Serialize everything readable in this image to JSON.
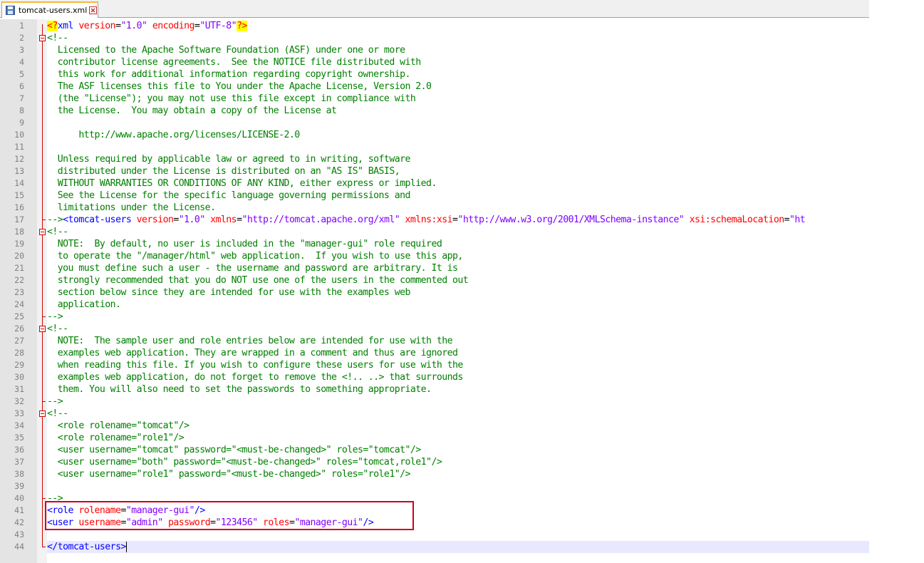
{
  "tab": {
    "filename": "tomcat-users.xml"
  },
  "lines": [
    [
      {
        "c": "pi",
        "t": "<?"
      },
      {
        "c": "tag",
        "t": "xml"
      },
      {
        "c": "text",
        "t": " "
      },
      {
        "c": "attr",
        "t": "version"
      },
      {
        "c": "text",
        "t": "="
      },
      {
        "c": "val",
        "t": "\"1.0\""
      },
      {
        "c": "text",
        "t": " "
      },
      {
        "c": "attr",
        "t": "encoding"
      },
      {
        "c": "text",
        "t": "="
      },
      {
        "c": "val",
        "t": "\"UTF-8\""
      },
      {
        "c": "pi",
        "t": "?>"
      }
    ],
    [
      {
        "c": "comment",
        "t": "<!--"
      }
    ],
    [
      {
        "c": "comment",
        "t": "  Licensed to the Apache Software Foundation (ASF) under one or more"
      }
    ],
    [
      {
        "c": "comment",
        "t": "  contributor license agreements.  See the NOTICE file distributed with"
      }
    ],
    [
      {
        "c": "comment",
        "t": "  this work for additional information regarding copyright ownership."
      }
    ],
    [
      {
        "c": "comment",
        "t": "  The ASF licenses this file to You under the Apache License, Version 2.0"
      }
    ],
    [
      {
        "c": "comment",
        "t": "  (the \"License\"); you may not use this file except in compliance with"
      }
    ],
    [
      {
        "c": "comment",
        "t": "  the License.  You may obtain a copy of the License at"
      }
    ],
    [
      {
        "c": "comment",
        "t": ""
      }
    ],
    [
      {
        "c": "comment",
        "t": "      http://www.apache.org/licenses/LICENSE-2.0"
      }
    ],
    [
      {
        "c": "comment",
        "t": ""
      }
    ],
    [
      {
        "c": "comment",
        "t": "  Unless required by applicable law or agreed to in writing, software"
      }
    ],
    [
      {
        "c": "comment",
        "t": "  distributed under the License is distributed on an \"AS IS\" BASIS,"
      }
    ],
    [
      {
        "c": "comment",
        "t": "  WITHOUT WARRANTIES OR CONDITIONS OF ANY KIND, either express or implied."
      }
    ],
    [
      {
        "c": "comment",
        "t": "  See the License for the specific language governing permissions and"
      }
    ],
    [
      {
        "c": "comment",
        "t": "  limitations under the License."
      }
    ],
    [
      {
        "c": "comment",
        "t": "-->"
      },
      {
        "c": "tag",
        "t": "<tomcat-users"
      },
      {
        "c": "text",
        "t": " "
      },
      {
        "c": "attr",
        "t": "version"
      },
      {
        "c": "text",
        "t": "="
      },
      {
        "c": "val",
        "t": "\"1.0\""
      },
      {
        "c": "text",
        "t": " "
      },
      {
        "c": "attr",
        "t": "xmlns"
      },
      {
        "c": "text",
        "t": "="
      },
      {
        "c": "val",
        "t": "\"http://tomcat.apache.org/xml\""
      },
      {
        "c": "text",
        "t": " "
      },
      {
        "c": "attr",
        "t": "xmlns:xsi"
      },
      {
        "c": "text",
        "t": "="
      },
      {
        "c": "val",
        "t": "\"http://www.w3.org/2001/XMLSchema-instance\""
      },
      {
        "c": "text",
        "t": " "
      },
      {
        "c": "attr",
        "t": "xsi:schemaLocation"
      },
      {
        "c": "text",
        "t": "="
      },
      {
        "c": "val",
        "t": "\"ht"
      }
    ],
    [
      {
        "c": "comment",
        "t": "<!--"
      }
    ],
    [
      {
        "c": "comment",
        "t": "  NOTE:  By default, no user is included in the \"manager-gui\" role required"
      }
    ],
    [
      {
        "c": "comment",
        "t": "  to operate the \"/manager/html\" web application.  If you wish to use this app,"
      }
    ],
    [
      {
        "c": "comment",
        "t": "  you must define such a user - the username and password are arbitrary. It is"
      }
    ],
    [
      {
        "c": "comment",
        "t": "  strongly recommended that you do NOT use one of the users in the commented out"
      }
    ],
    [
      {
        "c": "comment",
        "t": "  section below since they are intended for use with the examples web"
      }
    ],
    [
      {
        "c": "comment",
        "t": "  application."
      }
    ],
    [
      {
        "c": "comment",
        "t": "-->"
      }
    ],
    [
      {
        "c": "comment",
        "t": "<!--"
      }
    ],
    [
      {
        "c": "comment",
        "t": "  NOTE:  The sample user and role entries below are intended for use with the"
      }
    ],
    [
      {
        "c": "comment",
        "t": "  examples web application. They are wrapped in a comment and thus are ignored"
      }
    ],
    [
      {
        "c": "comment",
        "t": "  when reading this file. If you wish to configure these users for use with the"
      }
    ],
    [
      {
        "c": "comment",
        "t": "  examples web application, do not forget to remove the <!.. ..> that surrounds"
      }
    ],
    [
      {
        "c": "comment",
        "t": "  them. You will also need to set the passwords to something appropriate."
      }
    ],
    [
      {
        "c": "comment",
        "t": "-->"
      }
    ],
    [
      {
        "c": "comment",
        "t": "<!--"
      }
    ],
    [
      {
        "c": "comment",
        "t": "  <role rolename=\"tomcat\"/>"
      }
    ],
    [
      {
        "c": "comment",
        "t": "  <role rolename=\"role1\"/>"
      }
    ],
    [
      {
        "c": "comment",
        "t": "  <user username=\"tomcat\" password=\"<must-be-changed>\" roles=\"tomcat\"/>"
      }
    ],
    [
      {
        "c": "comment",
        "t": "  <user username=\"both\" password=\"<must-be-changed>\" roles=\"tomcat,role1\"/>"
      }
    ],
    [
      {
        "c": "comment",
        "t": "  <user username=\"role1\" password=\"<must-be-changed>\" roles=\"role1\"/>"
      }
    ],
    [
      {
        "c": "comment",
        "t": ""
      }
    ],
    [
      {
        "c": "comment",
        "t": "-->"
      }
    ],
    [
      {
        "c": "tag",
        "t": "<role"
      },
      {
        "c": "text",
        "t": " "
      },
      {
        "c": "attr",
        "t": "rolename"
      },
      {
        "c": "text",
        "t": "="
      },
      {
        "c": "val",
        "t": "\"manager-gui\""
      },
      {
        "c": "tag",
        "t": "/>"
      }
    ],
    [
      {
        "c": "tag",
        "t": "<user"
      },
      {
        "c": "text",
        "t": " "
      },
      {
        "c": "attr",
        "t": "username"
      },
      {
        "c": "text",
        "t": "="
      },
      {
        "c": "val",
        "t": "\"admin\""
      },
      {
        "c": "text",
        "t": " "
      },
      {
        "c": "attr",
        "t": "password"
      },
      {
        "c": "text",
        "t": "="
      },
      {
        "c": "val",
        "t": "\"123456\""
      },
      {
        "c": "text",
        "t": " "
      },
      {
        "c": "attr",
        "t": "roles"
      },
      {
        "c": "text",
        "t": "="
      },
      {
        "c": "val",
        "t": "\"manager-gui\""
      },
      {
        "c": "tag",
        "t": "/>"
      }
    ],
    [
      {
        "c": "text",
        "t": ""
      }
    ],
    [
      {
        "c": "tag",
        "t": "</tomcat-users>"
      }
    ]
  ],
  "colors": {
    "highlight_box": "#d0001c",
    "current_line": "#e8e8ff",
    "comment": "#008000",
    "tag": "#0000ff",
    "attribute": "#ff0000",
    "value": "#8000ff"
  }
}
